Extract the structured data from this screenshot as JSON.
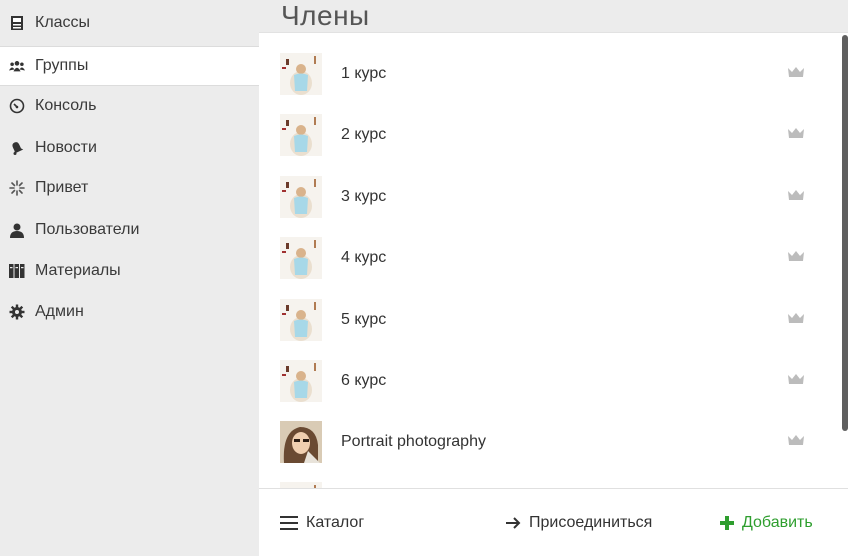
{
  "sidebar": {
    "items": [
      {
        "label": "Классы",
        "icon": "classes-icon"
      },
      {
        "label": "Группы",
        "icon": "groups-icon",
        "active": true
      },
      {
        "label": "Консоль",
        "icon": "dashboard-icon"
      },
      {
        "label": "Новости",
        "icon": "bell-icon"
      },
      {
        "label": "Привет",
        "icon": "sparkle-icon"
      },
      {
        "label": "Пользователи",
        "icon": "user-icon"
      },
      {
        "label": "Материалы",
        "icon": "books-icon"
      },
      {
        "label": "Админ",
        "icon": "gear-icon"
      }
    ]
  },
  "main": {
    "title": "Члены",
    "groups": [
      {
        "name": "1 курс",
        "thumb": "group-thumbnail"
      },
      {
        "name": "2 курс",
        "thumb": "group-thumbnail"
      },
      {
        "name": "3 курс",
        "thumb": "group-thumbnail"
      },
      {
        "name": "4 курс",
        "thumb": "group-thumbnail"
      },
      {
        "name": "5 курс",
        "thumb": "group-thumbnail"
      },
      {
        "name": "6 курс",
        "thumb": "group-thumbnail"
      },
      {
        "name": "Portrait photography",
        "thumb": "portrait-thumbnail"
      }
    ]
  },
  "footer": {
    "catalog": "Каталог",
    "join": "Присоединиться",
    "add": "Добавить"
  },
  "colors": {
    "sidebar_bg": "#ececec",
    "accent_green": "#2e9e2e",
    "crown": "#bcbcbc"
  }
}
